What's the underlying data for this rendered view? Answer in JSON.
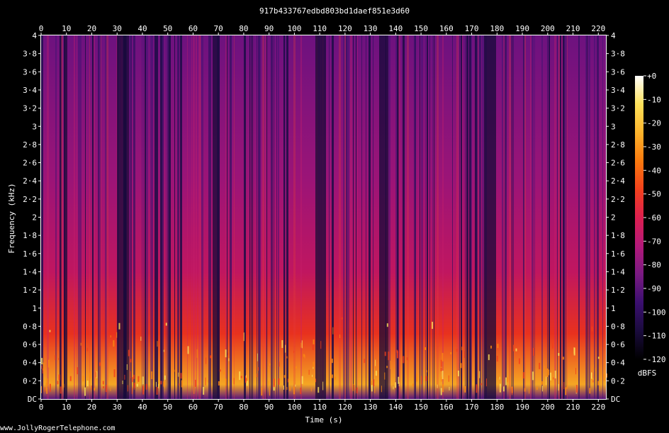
{
  "chart_data": {
    "type": "heatmap",
    "title": "917b433767edbd803bd1daef851e3d60",
    "xlabel": "Time (s)",
    "ylabel": "Frequency (kHz)",
    "xlim": [
      0,
      223
    ],
    "ylim": [
      0,
      4
    ],
    "x_ticks": [
      0,
      10,
      20,
      30,
      40,
      50,
      60,
      70,
      80,
      90,
      100,
      110,
      120,
      130,
      140,
      150,
      160,
      170,
      180,
      190,
      200,
      210,
      220
    ],
    "y_ticks": [
      {
        "value": 0,
        "label": "DC"
      },
      {
        "value": 0.2,
        "label": "0·2"
      },
      {
        "value": 0.4,
        "label": "0·4"
      },
      {
        "value": 0.6,
        "label": "0·6"
      },
      {
        "value": 0.8,
        "label": "0·8"
      },
      {
        "value": 1.0,
        "label": "1"
      },
      {
        "value": 1.2,
        "label": "1·2"
      },
      {
        "value": 1.4,
        "label": "1·4"
      },
      {
        "value": 1.6,
        "label": "1·6"
      },
      {
        "value": 1.8,
        "label": "1·8"
      },
      {
        "value": 2.0,
        "label": "2"
      },
      {
        "value": 2.2,
        "label": "2·2"
      },
      {
        "value": 2.4,
        "label": "2·4"
      },
      {
        "value": 2.6,
        "label": "2·6"
      },
      {
        "value": 2.8,
        "label": "2·8"
      },
      {
        "value": 3.0,
        "label": "3"
      },
      {
        "value": 3.2,
        "label": "3·2"
      },
      {
        "value": 3.4,
        "label": "3·4"
      },
      {
        "value": 3.6,
        "label": "3·6"
      },
      {
        "value": 3.8,
        "label": "3·8"
      },
      {
        "value": 4.0,
        "label": "4"
      }
    ],
    "colorbar": {
      "label": "dBFS",
      "ticks": [
        "+0",
        "-10",
        "-20",
        "-30",
        "-40",
        "-50",
        "-60",
        "-70",
        "-80",
        "-90",
        "-100",
        "-110",
        "-120"
      ],
      "range": [
        -120,
        0
      ],
      "colors": [
        "#000000",
        "#1a0b3d",
        "#3b0f70",
        "#7a1a82",
        "#b3197a",
        "#dd1f4f",
        "#f3411c",
        "#fb7a0e",
        "#fdb42c",
        "#fde15a",
        "#ffffff"
      ]
    }
  },
  "footer": "www.JollyRogerTelephone.com"
}
